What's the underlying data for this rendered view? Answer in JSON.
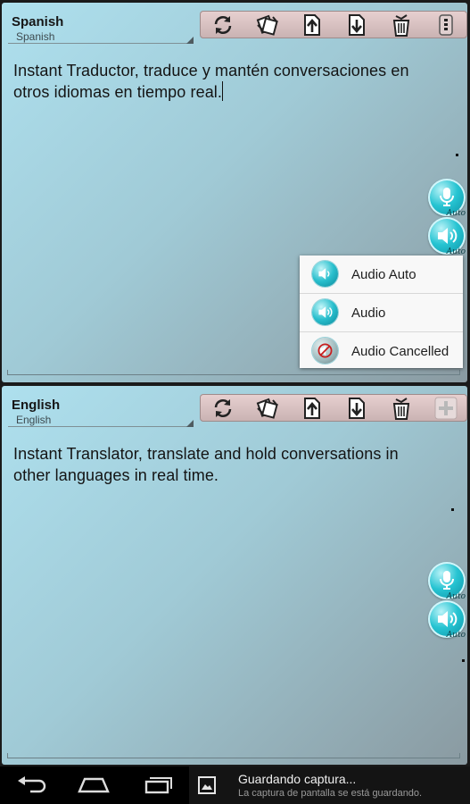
{
  "top_panel": {
    "language": "Spanish",
    "language_sub": "Spanish",
    "text": "Instant Traductor, traduce y mantén conversaciones en otros idiomas en tiempo real.",
    "mic_label": "Auto",
    "speaker_label": "Auto"
  },
  "bottom_panel": {
    "language": "English",
    "language_sub": "English",
    "text": "Instant Translator, translate and hold conversations in other languages in real time.",
    "mic_label": "Auto",
    "speaker_label": "Auto"
  },
  "toolbar_icons": [
    "refresh-icon",
    "swap-icon",
    "upload-icon",
    "download-icon",
    "trash-icon",
    "menu-icon"
  ],
  "toolbar_icons_bottom": [
    "refresh-icon",
    "swap-icon",
    "upload-icon",
    "download-icon",
    "trash-icon",
    "add-icon"
  ],
  "audio_menu": {
    "items": [
      {
        "label": "Audio Auto",
        "icon": "speaker-auto-icon"
      },
      {
        "label": "Audio",
        "icon": "speaker-icon"
      },
      {
        "label": "Audio Cancelled",
        "icon": "speaker-cancelled-icon"
      }
    ]
  },
  "notification": {
    "title": "Guardando captura...",
    "subtitle": "La captura de pantalla se está guardando."
  },
  "navbar": {
    "back_icon": "back-icon",
    "home_icon": "home-icon",
    "recents_icon": "recents-icon"
  },
  "colors": {
    "accent": "#27c4d2",
    "toolbar": "#d8c0c0",
    "panel": "#a0cad6"
  }
}
